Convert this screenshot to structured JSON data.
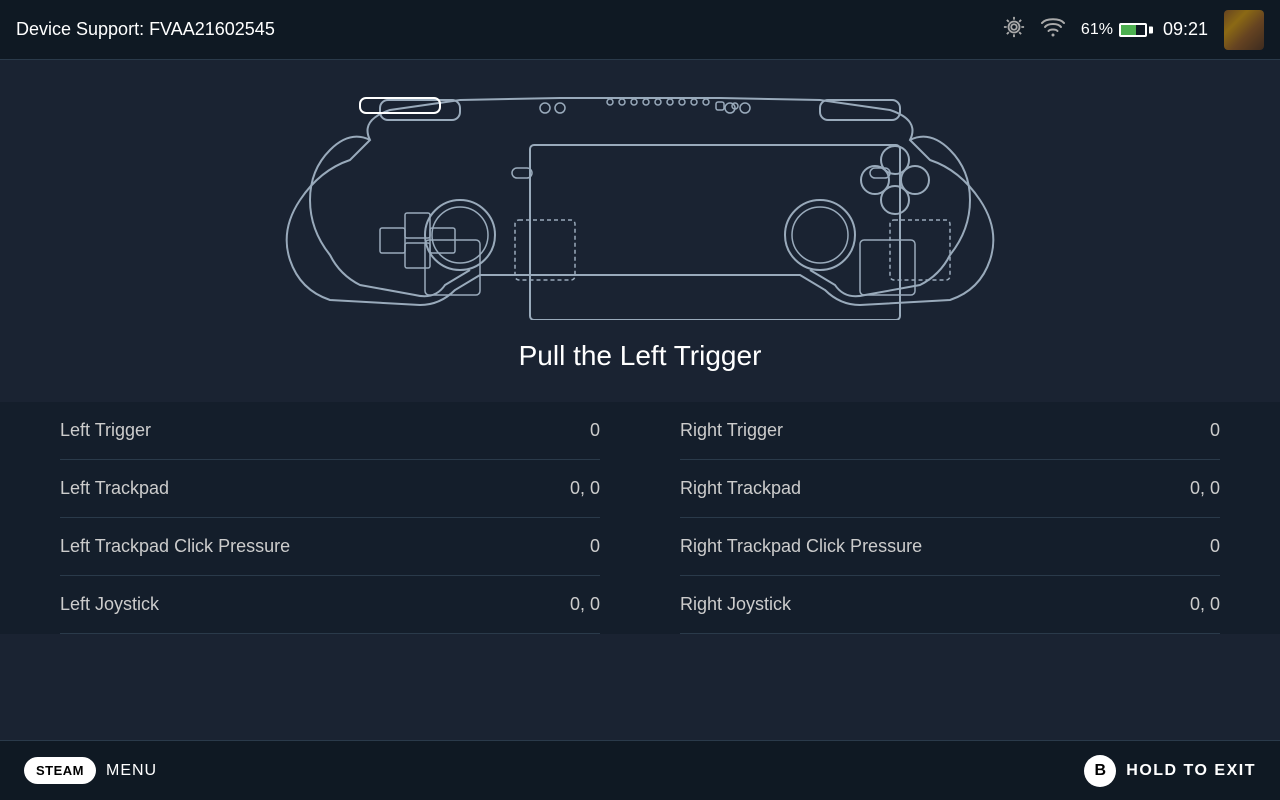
{
  "header": {
    "title": "Device Support: FVAA21602545",
    "battery_percent": "61%",
    "time": "09:21",
    "signal_label": "wifi signal"
  },
  "controller": {
    "instruction": "Pull the Left Trigger"
  },
  "data_rows": {
    "left": [
      {
        "label": "Left Trigger",
        "value": "0"
      },
      {
        "label": "Left Trackpad",
        "value": "0, 0"
      },
      {
        "label": "Left Trackpad Click Pressure",
        "value": "0"
      },
      {
        "label": "Left Joystick",
        "value": "0, 0"
      }
    ],
    "right": [
      {
        "label": "Right Trigger",
        "value": "0"
      },
      {
        "label": "Right Trackpad",
        "value": "0, 0"
      },
      {
        "label": "Right Trackpad Click Pressure",
        "value": "0"
      },
      {
        "label": "Right Joystick",
        "value": "0, 0"
      }
    ]
  },
  "footer": {
    "steam_label": "STEAM",
    "menu_label": "MENU",
    "hold_to_exit": "HOLD TO EXIT",
    "b_button_label": "B"
  }
}
